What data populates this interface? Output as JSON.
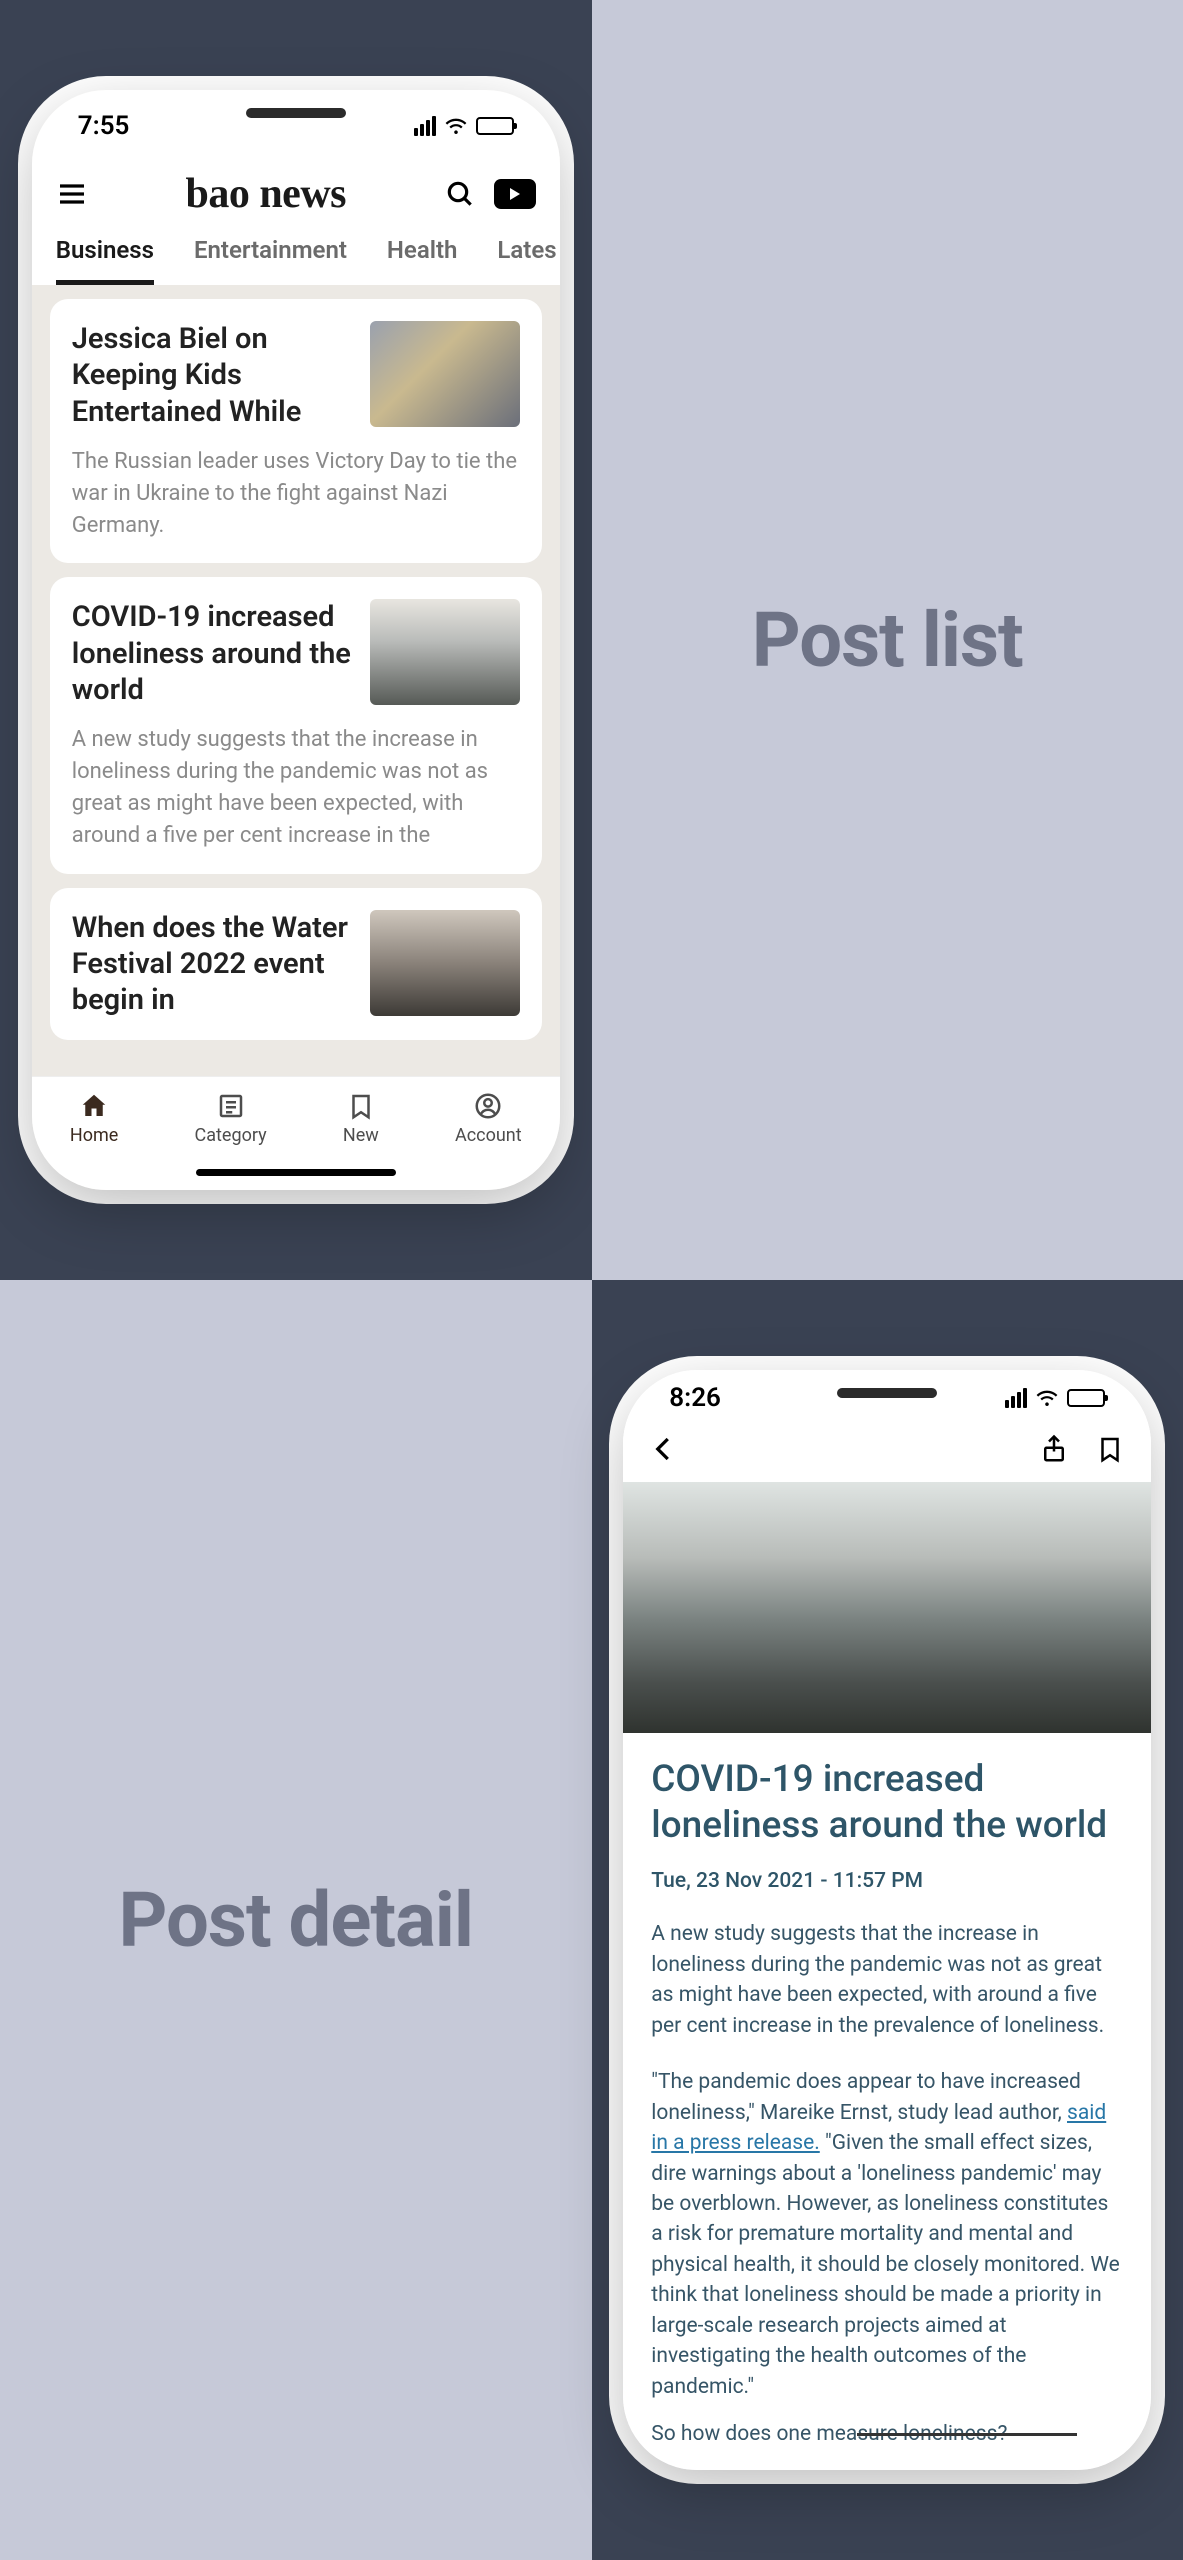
{
  "section_labels": {
    "list": "Post list",
    "detail": "Post detail"
  },
  "list_screen": {
    "status": {
      "time": "7:55"
    },
    "app_title": "bao news",
    "tabs": [
      "Business",
      "Entertainment",
      "Health",
      "Lates"
    ],
    "cards": [
      {
        "title": "Jessica Biel on Keeping Kids Entertained While",
        "summary": "The Russian leader uses Victory Day to tie the war in Ukraine to the fight against Nazi Germany."
      },
      {
        "title": "COVID-19 increased loneliness around the world",
        "summary": "A new study suggests that the increase in loneliness during the pandemic was not as great as might have been expected, with around a five per cent increase in the"
      },
      {
        "title": "When does the Water Festival 2022 event begin in",
        "summary": ""
      }
    ],
    "nav": {
      "home": "Home",
      "category": "Category",
      "new": "New",
      "account": "Account"
    }
  },
  "detail_screen": {
    "status": {
      "time": "8:26"
    },
    "title": "COVID-19 increased loneliness around the world",
    "date": "Tue, 23 Nov 2021 - 11:57 PM",
    "para1": "A new study suggests that the increase in loneliness during the pandemic was not as great as might have been expected, with around a five per cent increase in the prevalence of loneliness.",
    "quote_lead": "\"The pandemic does appear to have increased loneliness,\" Mareike Ernst, study lead author, ",
    "quote_link": "said in a press release.",
    "quote_tail": " \"Given the small effect sizes, dire warnings about a 'loneliness pandemic' may be overblown. However, as loneliness constitutes a risk for premature mortality and mental and physical health, it should be closely monitored. We think that loneliness should be made a priority in large-scale research projects aimed at investigating the health outcomes of the pandemic.\"",
    "cutoff": "So how does one measure loneliness?"
  }
}
